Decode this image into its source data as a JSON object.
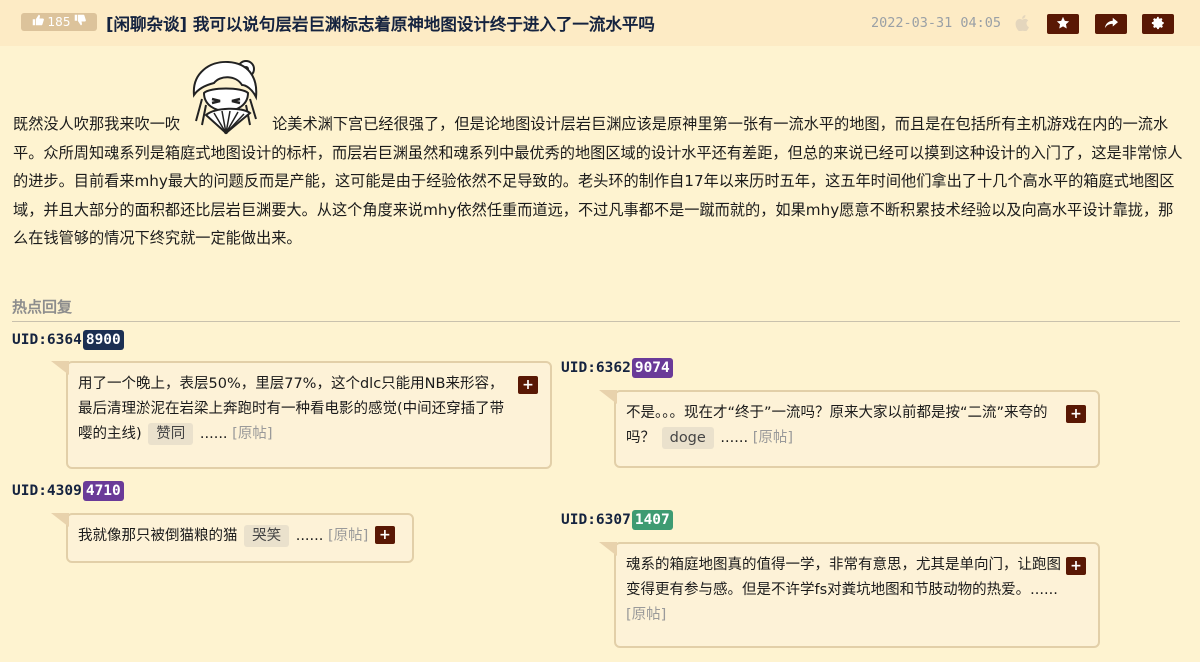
{
  "header": {
    "vote_count": "185",
    "title": "[闲聊杂谈] 我可以说句层岩巨渊标志着原神地图设计终于进入了一流水平吗",
    "post_time": "2022-03-31 04:05",
    "icons": [
      "thumb-up-icon",
      "thumb-down-icon",
      "apple-icon",
      "star-icon",
      "share-icon",
      "gear-icon"
    ]
  },
  "post": {
    "text_before_sticker": "既然没人吹那我来吹一吹",
    "text_after_sticker": "论美术渊下宫已经很强了，但是论地图设计层岩巨渊应该是原神里第一张有一流水平的地图，而且是在包括所有主机游戏在内的一流水平。众所周知魂系列是箱庭式地图设计的标杆，而层岩巨渊虽然和魂系列中最优秀的地图区域的设计水平还有差距，但总的来说已经可以摸到这种设计的入门了，这是非常惊人的进步。目前看来mhy最大的问题反而是产能，这可能是由于经验依然不足导致的。老头环的制作自17年以来历时五年，这五年时间他们拿出了十几个高水平的箱庭式地图区域，并且大部分的面积都还比层岩巨渊要大。从这个角度来说mhy依然任重而道远，不过凡事都不是一蹴而就的，如果mhy愿意不断积累技术经验以及向高水平设计靠拢，那么在钱管够的情况下终究就一定能做出来。"
  },
  "hot_replies": {
    "section_title": "热点回复",
    "orig_label": "[原帖]",
    "ellipsis": "......",
    "plus_label": "+",
    "items": [
      {
        "uid_prefix": "UID:6364",
        "uid_tail": "8900",
        "tail_color": "#1c2f52",
        "text": "用了一个晚上，表层50%，里层77%，这个dlc只能用NB来形容，最后清理淤泥在岩梁上奔跑时有一种看电影的感觉(中间还穿插了带嘤的主线)",
        "tag": "赞同"
      },
      {
        "uid_prefix": "UID:6362",
        "uid_tail": "9074",
        "tail_color": "#6a3a98",
        "text": "不是。。。现在才“终于”一流吗？原来大家以前都是按“二流”来夸的吗？",
        "tag": "doge"
      },
      {
        "uid_prefix": "UID:4309",
        "uid_tail": "4710",
        "tail_color": "#6a3a98",
        "text": "我就像那只被倒猫粮的猫",
        "tag": "哭笑"
      },
      {
        "uid_prefix": "UID:6307",
        "uid_tail": "1407",
        "tail_color": "#3e9b72",
        "text": "魂系的箱庭地图真的值得一学，非常有意思，尤其是单向门，让跑图变得更有参与感。但是不许学fs对粪坑地图和节肢动物的热爱。",
        "tag": ""
      }
    ]
  }
}
